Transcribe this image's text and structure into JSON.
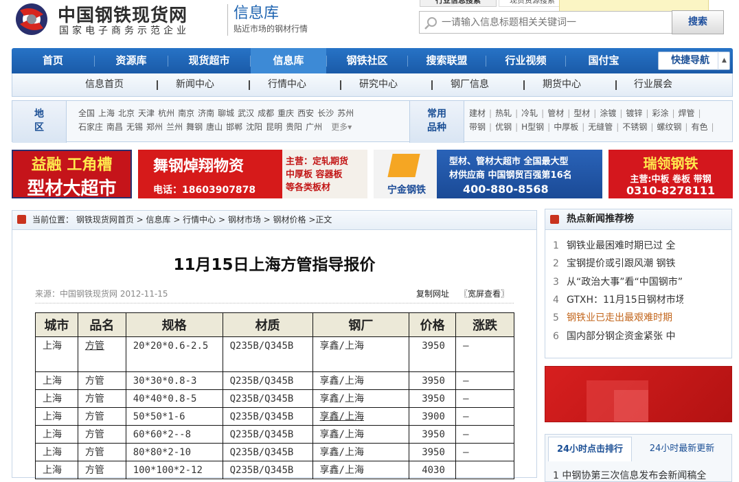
{
  "header": {
    "brand": "中国钢铁现货网",
    "brand_sub": "国家电子商务示范企业",
    "section": "信息库",
    "section_sub": "贴近市场的钢材行情",
    "search_tabs": [
      "行业信息搜索",
      "现货资源搜索"
    ],
    "search_placeholder": "一请输入信息标题相关关键词一",
    "search_button": "搜索"
  },
  "main_nav": [
    "首页",
    "资源库",
    "现货超市",
    "信息库",
    "钢铁社区",
    "搜索联盟",
    "行业视频",
    "国付宝"
  ],
  "quick_nav": "快捷导航",
  "sub_nav": [
    "信息首页",
    "新闻中心",
    "行情中心",
    "研究中心",
    "钢厂信息",
    "期货中心",
    "行业展会"
  ],
  "region": {
    "label": "地区",
    "row1": [
      "全国",
      "上海",
      "北京",
      "天津",
      "杭州",
      "南京",
      "济南",
      "聊城",
      "武汉",
      "成都",
      "重庆",
      "西安",
      "长沙",
      "苏州"
    ],
    "row2": [
      "石家庄",
      "南昌",
      "无锡",
      "郑州",
      "兰州",
      "舞钢",
      "唐山",
      "邯郸",
      "沈阳",
      "昆明",
      "贵阳",
      "广州"
    ],
    "more": "更多"
  },
  "varieties": {
    "label": "常用品种",
    "row1": [
      "建材",
      "热轧",
      "冷轧",
      "管材",
      "型材",
      "涂镀",
      "镀锌",
      "彩涂",
      "焊管"
    ],
    "row2": [
      "带钢",
      "优钢",
      "H型钢",
      "中厚板",
      "无缝管",
      "不锈钢",
      "螺纹钢",
      "有色"
    ]
  },
  "banners": [
    {
      "line1": "益融 工角槽",
      "line2": "型材大超市"
    },
    {
      "title": "舞钢焯翔物资",
      "phone": "电话：18603907878",
      "lines": [
        "主营：定轧期货",
        "中厚板 容器板",
        "等各类板材"
      ]
    },
    {
      "brand": "宁金钢铁",
      "line1": "型材、管材大超市 全国最大型",
      "line2": "材供应商 中国钢贸百强第16名",
      "phone": "400-880-8568"
    },
    {
      "title": "瑞领钢铁",
      "line": "主营:中板 卷板 带钢",
      "phone": "0310-8278111"
    }
  ],
  "breadcrumb": "当前位置：  钢铁现货网首页  >  信息库  >  行情中心  >  钢材市场  >  钢材价格  >正文",
  "article": {
    "title": "11月15日上海方管指导报价",
    "source": "来源：中国钢铁现货网 2012-11-15",
    "copy_link": "复制网址",
    "wide_view": "〖宽屏查看〗",
    "headers": [
      "城市",
      "品名",
      "规格",
      "材质",
      "钢厂",
      "价格",
      "涨跌"
    ],
    "rows": [
      [
        "上海",
        "方管",
        "20*20*0.6-2.5",
        "Q235B/Q345B",
        "享鑫/上海",
        "3950",
        "—"
      ],
      [
        "上海",
        "方管",
        "30*30*0.8-3",
        "Q235B/Q345B",
        "享鑫/上海",
        "3950",
        "—"
      ],
      [
        "上海",
        "方管",
        "40*40*0.8-5",
        "Q235B/Q345B",
        "享鑫/上海",
        "3950",
        "—"
      ],
      [
        "上海",
        "方管",
        "50*50*1-6",
        "Q235B/Q345B",
        "享鑫/上海",
        "3900",
        "—"
      ],
      [
        "上海",
        "方管",
        "60*60*2--8",
        "Q235B/Q345B",
        "享鑫/上海",
        "3950",
        "—"
      ],
      [
        "上海",
        "方管",
        "80*80*2-10",
        "Q235B/Q345B",
        "享鑫/上海",
        "3950",
        "—"
      ],
      [
        "上海",
        "方管",
        "100*100*2-12",
        "Q235B/Q345B",
        "享鑫/上海",
        "4030",
        ""
      ]
    ]
  },
  "hot_news": {
    "title": "热点新闻推荐榜",
    "items": [
      {
        "n": "1",
        "text": "钢铁业最困难时期已过 全"
      },
      {
        "n": "2",
        "text": "宝钢提价或引跟风潮 钢铁"
      },
      {
        "n": "3",
        "text": "从“政治大事”看“中国钢市”"
      },
      {
        "n": "4",
        "text": "GTXH：11月15日钢材市场"
      },
      {
        "n": "5",
        "text": "钢铁业已走出最艰难时期"
      },
      {
        "n": "6",
        "text": "国内部分钢企资金紧张 中"
      }
    ]
  },
  "rank": {
    "tab1": "24小时点击排行",
    "tab2": "24小时最新更新",
    "item1": "1 中钢协第三次信息发布会新闻稿全"
  },
  "colors": {
    "nav_blue": "#1a5aa8",
    "link_orange": "#c2651b",
    "accent_red": "#c9331e"
  }
}
